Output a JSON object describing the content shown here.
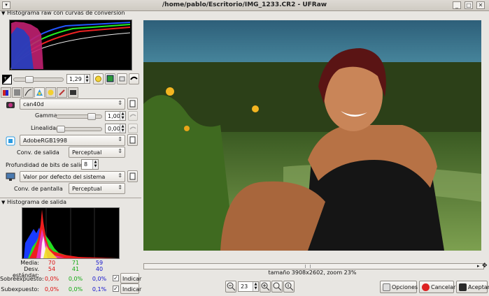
{
  "window": {
    "title": "/home/pablo/Escritorio/IMG_1233.CR2 - UFRaw",
    "menu_icon": "ufraw-window-menu-icon",
    "close_symbol": "✕",
    "maximize_symbol": "□",
    "minimize_symbol": "_"
  },
  "raw_histogram": {
    "title": "Histograma raw con curvas de conversion",
    "collapse_arrow": "▼"
  },
  "exposure": {
    "value": "1,29"
  },
  "tabs": [
    "white-balance",
    "grayscale",
    "base-curve",
    "color-management",
    "lightness",
    "corrections",
    "transform",
    "exif"
  ],
  "color_management": {
    "input_profile": "can40d",
    "gamma_label": "Gamma",
    "gamma_value": "1,00",
    "gamma_level": 0.82,
    "linearity_label": "Linealidad",
    "linearity_value": "0,00",
    "linearity_level": 0.0,
    "output_profile": "AdobeRGB1998",
    "output_intent_label": "Conv. de salida",
    "output_intent": "Perceptual",
    "bit_depth_label": "Profundidad de bits de salida",
    "bit_depth": "8",
    "display_profile": "Valor por defecto del sistema",
    "display_intent_label": "Conv. de pantalla",
    "display_intent": "Perceptual"
  },
  "output_histogram": {
    "title": "Histograma de salida",
    "collapse_arrow": "▼",
    "rows": [
      {
        "label": "Media:",
        "r": "70",
        "g": "71",
        "b": "59"
      },
      {
        "label": "Desv. estándar:",
        "r": "54",
        "g": "41",
        "b": "40"
      }
    ],
    "overexposed": {
      "label": "Sobreexpuesto:",
      "r": "0,0%",
      "g": "0,0%",
      "b": "0,0%",
      "checked": true,
      "button": "Indicar"
    },
    "underexposed": {
      "label": "Subexpuesto:",
      "r": "0,0%",
      "g": "0,0%",
      "b": "0,1%",
      "checked": true,
      "button": "Indicar"
    }
  },
  "preview": {
    "status": "tamaño 3908x2602, zoom 23%",
    "zoom_value": "23"
  },
  "buttons": {
    "options": "Opciones",
    "cancel": "Cancelar",
    "accept": "Aceptar"
  },
  "colors": {
    "red": "#d11111",
    "green": "#11aa11",
    "blue": "#1111cc"
  }
}
